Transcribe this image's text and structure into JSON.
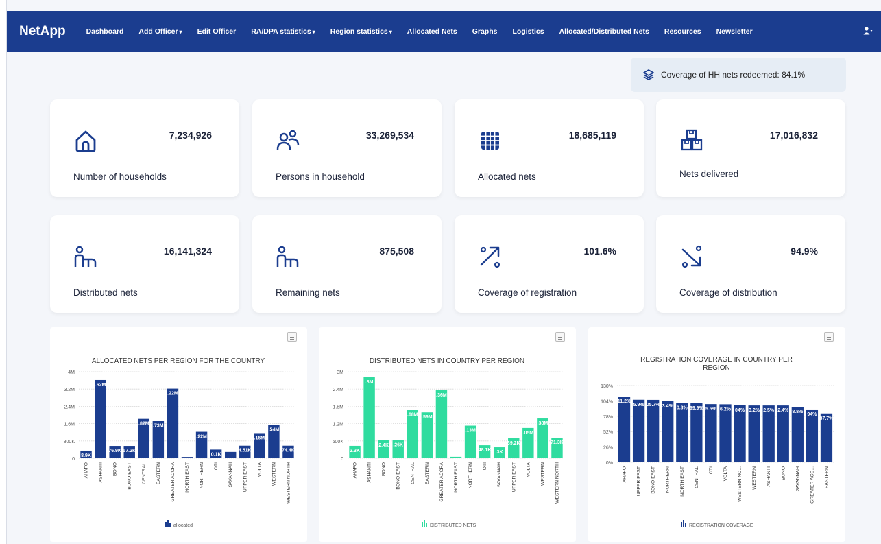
{
  "nav": {
    "brand": "NetApp",
    "items": [
      {
        "label": "Dashboard",
        "dropdown": false
      },
      {
        "label": "Add Officer",
        "dropdown": true
      },
      {
        "label": "Edit Officer",
        "dropdown": false
      },
      {
        "label": "RA/DPA statistics",
        "dropdown": true
      },
      {
        "label": "Region statistics",
        "dropdown": true
      },
      {
        "label": "Allocated Nets",
        "dropdown": false
      },
      {
        "label": "Graphs",
        "dropdown": false
      },
      {
        "label": "Logistics",
        "dropdown": false
      },
      {
        "label": "Allocated/Distributed Nets",
        "dropdown": false
      },
      {
        "label": "Resources",
        "dropdown": false
      },
      {
        "label": "Newsletter",
        "dropdown": false
      }
    ]
  },
  "coverage_banner": {
    "text": "Coverage of HH nets redeemed: 84.1%"
  },
  "stats": [
    {
      "icon": "home-icon",
      "value": "7,234,926",
      "label": "Number of households"
    },
    {
      "icon": "people-icon",
      "value": "33,269,534",
      "label": "Persons in household"
    },
    {
      "icon": "grid-icon",
      "value": "18,685,119",
      "label": "Allocated nets"
    },
    {
      "icon": "boxes-icon",
      "value": "17,016,832",
      "label": "Nets delivered"
    },
    {
      "icon": "bed-icon",
      "value": "16,141,324",
      "label": "Distributed nets"
    },
    {
      "icon": "bed-icon",
      "value": "875,508",
      "label": "Remaining nets"
    },
    {
      "icon": "arrow-up-right-icon",
      "value": "101.6%",
      "label": "Coverage of registration"
    },
    {
      "icon": "arrow-down-right-icon",
      "value": "94.9%",
      "label": "Coverage of distribution"
    }
  ],
  "colors": {
    "nav": "#1b3d8f",
    "bar_allocated": "#1b3d8f",
    "bar_distributed": "#2fdc9f",
    "bar_coverage": "#1b3d8f"
  },
  "chart_data": [
    {
      "type": "bar",
      "title": "ALLOCATED NETS PER REGION FOR THE COUNTRY",
      "categories": [
        "AHAFO",
        "ASHANTI",
        "BONO",
        "BONO EAST",
        "CENTRAL",
        "EASTERN",
        "GREATER ACCRA",
        "NORTH EAST",
        "NORTHERN",
        "OTI",
        "SAVANNAH",
        "UPPER EAST",
        "VOLTA",
        "WESTERN",
        "WESTERN NORTH"
      ],
      "values": [
        0.35,
        3.62,
        0.57,
        0.57,
        1.82,
        1.73,
        3.22,
        0.06,
        1.22,
        0.4,
        0.29,
        0.58,
        1.16,
        1.54,
        0.58
      ],
      "data_labels": [
        "8.9K",
        ".62M",
        "76.9K",
        "57.2K",
        ".82M",
        ".73M",
        ".22M",
        "",
        ".22M",
        "0.1K",
        "",
        "4.51K",
        ".16M",
        ".54M",
        "74.4K"
      ],
      "yticks": [
        "0",
        "800K",
        "1.6M",
        "2.4M",
        "3.2M",
        "4M"
      ],
      "ylim": [
        0,
        4
      ],
      "legend": "allocated"
    },
    {
      "type": "bar",
      "title": "DISTRIBUTED NETS IN COUNTRY PER REGION",
      "categories": [
        "AHAFO",
        "ASHANTI",
        "BONO",
        "BONO EAST",
        "CENTRAL",
        "EASTERN",
        "GREATER ACCRA",
        "NORTH EAST",
        "NORTHERN",
        "OTI",
        "SAVANNAH",
        "UPPER EAST",
        "VOLTA",
        "WESTERN",
        "WESTERN NORTH"
      ],
      "values": [
        0.43,
        2.81,
        0.62,
        0.63,
        1.68,
        1.59,
        2.36,
        0.05,
        1.13,
        0.45,
        0.38,
        0.69,
        1.05,
        1.38,
        0.71
      ],
      "data_labels": [
        "2.3K",
        ".8M",
        "2.4K",
        ".26K",
        ".68M",
        ".59M",
        ".36M",
        "",
        ".13M",
        "48.1K",
        ".3K",
        "39.2K",
        ".05M",
        ".38M",
        "71.3K"
      ],
      "yticks": [
        "0",
        "600K",
        "1.2M",
        "1.8M",
        "2.4M",
        "3M"
      ],
      "ylim": [
        0,
        3
      ],
      "legend": "DISTRIBUTED NETS"
    },
    {
      "type": "bar",
      "title_lines": [
        "REGISTRATION COVERAGE IN COUNTRY PER",
        "REGION"
      ],
      "categories": [
        "AHAFO",
        "UPPER EAST",
        "BONO EAST",
        "NORTHERN",
        "NORTH EAST",
        "CENTRAL",
        "OTI",
        "VOLTA",
        "WESTERN NO...",
        "WESTERN",
        "ASHANTI",
        "BONO",
        "SAVANNAH",
        "GREATER ACC...",
        "EASTERN"
      ],
      "values": [
        111.2,
        105.9,
        105.7,
        103.4,
        100.3,
        99.9,
        98.5,
        98.2,
        96.4,
        96.2,
        96.2,
        96.2,
        93.8,
        89.4,
        82.7
      ],
      "data_labels": [
        "11.2%",
        "5.9%",
        "05.7%",
        "3.4%",
        "0.3%",
        "99.9%",
        "5.5%",
        "6.2%",
        "04%",
        "3.2%",
        "2.5%",
        "2.4%",
        "8.8%",
        "94%",
        "87.7%"
      ],
      "yticks": [
        "0%",
        "26%",
        "52%",
        "78%",
        "104%",
        "130%"
      ],
      "ylim": [
        0,
        130
      ],
      "legend": "REGISTRATION COVERAGE"
    }
  ]
}
